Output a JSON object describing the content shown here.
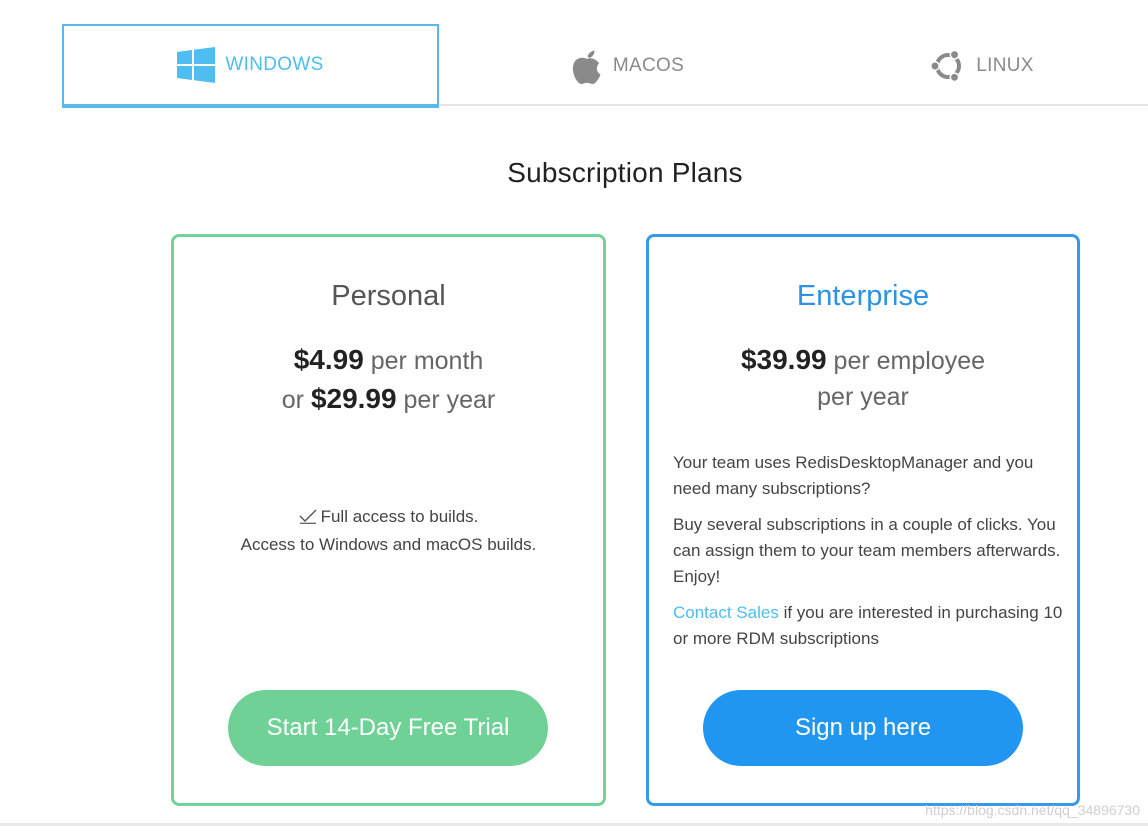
{
  "tabs": [
    {
      "label": "WINDOWS",
      "icon": "windows-icon",
      "active": true
    },
    {
      "label": "MACOS",
      "icon": "apple-icon",
      "active": false
    },
    {
      "label": "LINUX",
      "icon": "ubuntu-icon",
      "active": false
    }
  ],
  "page_title": "Subscription Plans",
  "plans": {
    "personal": {
      "name": "Personal",
      "price_monthly": "$4.99",
      "monthly_suffix": "per month",
      "or_label": "or",
      "price_yearly": "$29.99",
      "yearly_suffix": "per year",
      "features": [
        "Full access to builds.",
        "Access to Windows and macOS builds."
      ],
      "cta": "Start 14-Day Free Trial"
    },
    "enterprise": {
      "name": "Enterprise",
      "price": "$39.99",
      "price_suffix": "per employee",
      "price_suffix2": "per year",
      "description_1": "Your team uses RedisDesktopManager and you need many subscriptions?",
      "description_2": "Buy several subscriptions in a couple of clicks. You can assign them to your team members afterwards. Enjoy!",
      "contact_link": "Contact Sales",
      "description_3": " if you are interested in purchasing 10 or more RDM subscriptions",
      "cta": "Sign up here"
    }
  },
  "watermark": "https://blog.csdn.net/qq_34896730",
  "colors": {
    "windows_accent": "#4fbdf0",
    "personal_border": "#72d39a",
    "enterprise_border": "#3a98e8",
    "personal_button": "#6fd196",
    "enterprise_button": "#2196f0",
    "inactive_tab": "#8a8a8a"
  }
}
